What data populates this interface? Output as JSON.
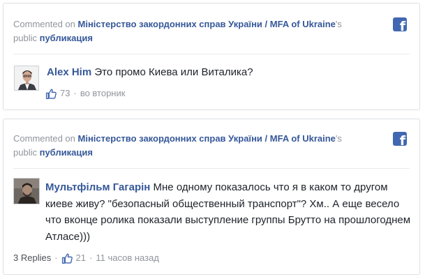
{
  "comments": [
    {
      "header_prefix": "Commented on",
      "page_name": "Міністерство закордонних справ України / MFA of Ukraine",
      "possessive": "'s",
      "public_word": "public",
      "post_word": "публикация",
      "author": "Alex Him",
      "text": "Это промо Киева или Виталика?",
      "like_count": "73",
      "separator": "·",
      "time": "во вторник"
    },
    {
      "header_prefix": "Commented on",
      "page_name": "Міністерство закордонних справ України / MFA of Ukraine",
      "possessive": "'s",
      "public_word": "public",
      "post_word": "публикация",
      "author": "Мультфільм Гагарін",
      "text": "Мне одному показалось что я в каком то другом киеве живу? \"безопасный общественный транспорт\"? Хм.. А еще весело что вконце ролика показали выступление группы Брутто на прошлогоднем Атласе)))",
      "replies": "3 Replies",
      "like_count": "21",
      "separator": "·",
      "time": "11 часов назад"
    }
  ],
  "colors": {
    "link": "#365899",
    "muted": "#90949c",
    "text": "#1d2129",
    "facebook_blue": "#4267b2"
  },
  "icons": [
    "facebook-logo-icon",
    "thumbs-up-icon"
  ]
}
